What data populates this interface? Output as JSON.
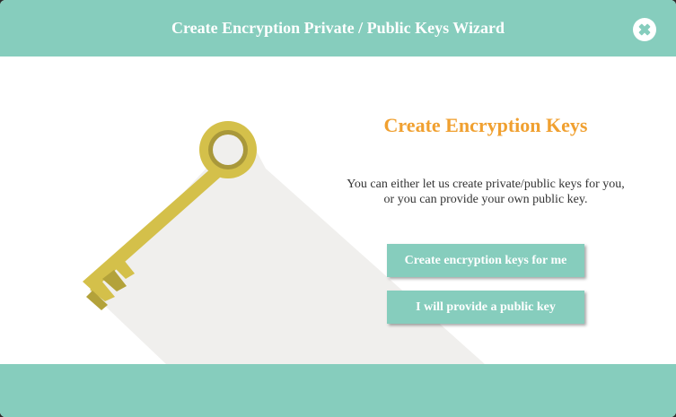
{
  "header": {
    "title": "Create Encryption Private / Public Keys Wizard",
    "close_icon": "close-icon"
  },
  "main": {
    "illustration": "key-icon",
    "heading": "Create Encryption Keys",
    "description_line1": "You can either let us create private/public keys for you,",
    "description_line2": "or you can provide your own public key.",
    "buttons": {
      "create_label": "Create encryption keys for me",
      "provide_label": "I will provide a public key"
    }
  },
  "colors": {
    "accent": "#86cdbd",
    "heading": "#f0a030",
    "key": "#d4c04a",
    "key_dark": "#b3a23a",
    "shadow": "#f0efed"
  }
}
